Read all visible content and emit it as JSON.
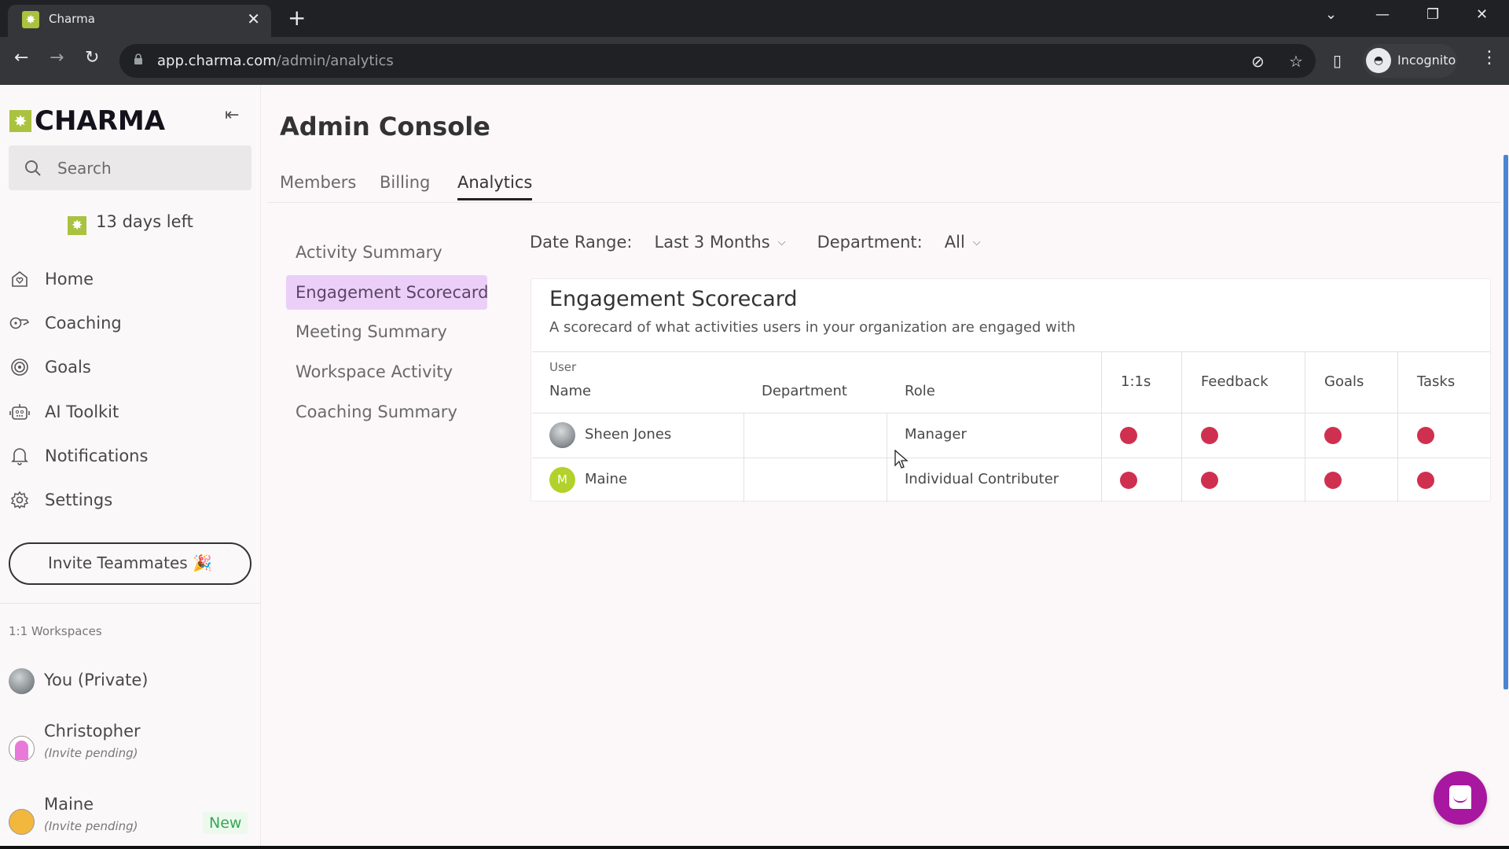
{
  "browser": {
    "tab_title": "Charma",
    "url_host": "app.charma.com",
    "url_path": "/admin/analytics",
    "profile_label": "Incognito"
  },
  "sidebar": {
    "brand": "CHARMA",
    "search_placeholder": "Search",
    "trial_text": "13 days left",
    "nav": [
      {
        "label": "Home",
        "icon": "home-heart-icon"
      },
      {
        "label": "Coaching",
        "icon": "whistle-icon"
      },
      {
        "label": "Goals",
        "icon": "target-icon"
      },
      {
        "label": "AI Toolkit",
        "icon": "robot-icon"
      },
      {
        "label": "Notifications",
        "icon": "bell-icon"
      },
      {
        "label": "Settings",
        "icon": "gear-icon"
      }
    ],
    "invite_label": "Invite Teammates 🎉",
    "workspaces_heading": "1:1 Workspaces",
    "workspaces": [
      {
        "name": "You (Private)",
        "sub": "",
        "badge": ""
      },
      {
        "name": "Christopher",
        "sub": "(Invite pending)",
        "badge": ""
      },
      {
        "name": "Maine",
        "sub": "(Invite pending)",
        "badge": "New"
      }
    ]
  },
  "main": {
    "title": "Admin Console",
    "tabs": [
      {
        "label": "Members",
        "active": false
      },
      {
        "label": "Billing",
        "active": false
      },
      {
        "label": "Analytics",
        "active": true
      }
    ],
    "subnav": [
      {
        "label": "Activity Summary",
        "active": false
      },
      {
        "label": "Engagement Scorecard",
        "active": true
      },
      {
        "label": "Meeting Summary",
        "active": false
      },
      {
        "label": "Workspace Activity",
        "active": false
      },
      {
        "label": "Coaching Summary",
        "active": false
      }
    ],
    "filters": {
      "date_range_label": "Date Range:",
      "date_range_value": "Last 3 Months",
      "department_label": "Department:",
      "department_value": "All"
    },
    "scorecard": {
      "title": "Engagement Scorecard",
      "description": "A scorecard of what activities users in your organization are engaged with",
      "header_group": "User",
      "columns": [
        "Name",
        "Department",
        "Role",
        "1:1s",
        "Feedback",
        "Goals",
        "Tasks"
      ],
      "rows": [
        {
          "name": "Sheen Jones",
          "avatar": "photo",
          "department": "",
          "role": "Manager",
          "one_on_ones": "inactive",
          "feedback": "inactive",
          "goals": "inactive",
          "tasks": "inactive"
        },
        {
          "name": "Maine",
          "avatar_initial": "M",
          "department": "",
          "role": "Individual Contributer",
          "one_on_ones": "inactive",
          "feedback": "inactive",
          "goals": "inactive",
          "tasks": "inactive"
        }
      ],
      "status_colors": {
        "inactive": "#d0304f"
      }
    }
  },
  "colors": {
    "brand_green": "#a9c23f",
    "active_subnav_bg": "#ebcff8",
    "chat_fab": "#a8179f",
    "new_badge_text": "#3aa657"
  }
}
